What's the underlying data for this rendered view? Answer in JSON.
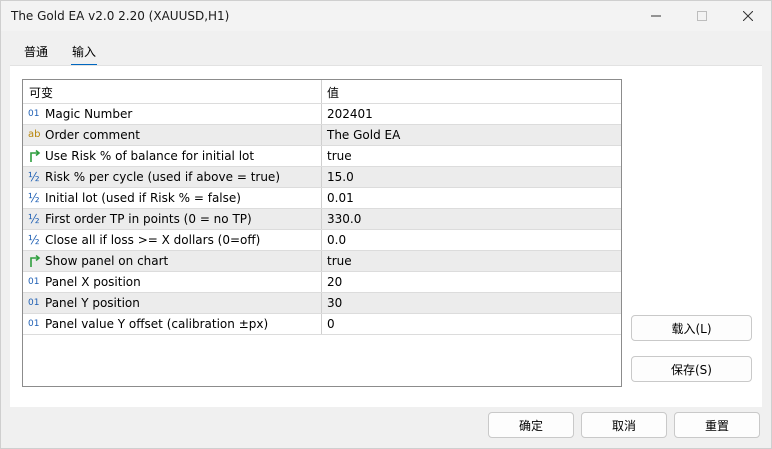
{
  "window": {
    "title": "The Gold EA v2.0 2.20 (XAUUSD,H1)"
  },
  "tabs": [
    {
      "label": "普通"
    },
    {
      "label": "输入"
    }
  ],
  "grid": {
    "columns": {
      "name": "可变",
      "value": "值"
    },
    "rows": [
      {
        "icon": "01",
        "icon_name": "integer-icon",
        "name": "Magic Number",
        "value": "202401"
      },
      {
        "icon": "ab",
        "icon_name": "string-icon",
        "name": "Order comment",
        "value": "The Gold EA"
      },
      {
        "icon": "bool",
        "icon_name": "boolean-icon",
        "name": "Use Risk % of balance for initial lot",
        "value": "true"
      },
      {
        "icon": "½",
        "icon_name": "double-icon",
        "name": "Risk % per cycle (used if above = true)",
        "value": "15.0"
      },
      {
        "icon": "½",
        "icon_name": "double-icon",
        "name": "Initial lot (used if Risk % = false)",
        "value": "0.01"
      },
      {
        "icon": "½",
        "icon_name": "double-icon",
        "name": "First order TP in points (0 = no TP)",
        "value": "330.0"
      },
      {
        "icon": "½",
        "icon_name": "double-icon",
        "name": "Close all if loss >= X dollars (0=off)",
        "value": "0.0"
      },
      {
        "icon": "bool",
        "icon_name": "boolean-icon",
        "name": "Show panel on chart",
        "value": "true"
      },
      {
        "icon": "01",
        "icon_name": "integer-icon",
        "name": "Panel X position",
        "value": "20"
      },
      {
        "icon": "01",
        "icon_name": "integer-icon",
        "name": "Panel Y position",
        "value": "30"
      },
      {
        "icon": "01",
        "icon_name": "integer-icon",
        "name": "Panel value Y offset (calibration ±px)",
        "value": "0"
      }
    ]
  },
  "side_buttons": {
    "load": "载入(L)",
    "save": "保存(S)"
  },
  "footer_buttons": {
    "ok": "确定",
    "cancel": "取消",
    "reset": "重置"
  },
  "colors": {
    "accent": "#0067c0",
    "int_icon": "#1e5fb4",
    "string_icon": "#b8860b",
    "bool_icon": "#2e9e3e"
  }
}
